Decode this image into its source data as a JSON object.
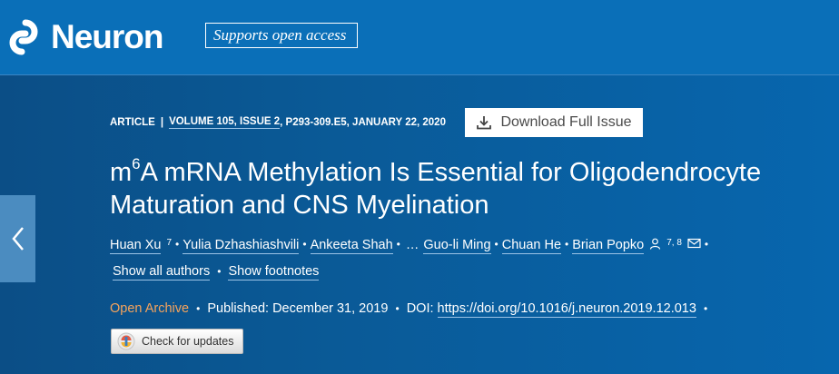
{
  "header": {
    "journal_name": "Neuron",
    "open_access_badge": "Supports open access"
  },
  "article": {
    "type": "ARTICLE",
    "separator": "|",
    "volume": "VOLUME 105, ISSUE 2",
    "pages_date": ", P293-309.E5, JANUARY 22, 2020",
    "download_label": "Download Full Issue",
    "title_prefix": "m",
    "title_sup": "6",
    "title_rest": "A mRNA Methylation Is Essential for Oligodendrocyte Maturation and CNS Myelination",
    "authors": [
      {
        "name": "Huan Xu",
        "sup": "7"
      },
      {
        "name": "Yulia Dzhashiashvili"
      },
      {
        "name": "Ankeeta Shah"
      },
      {
        "name": "Guo-li Ming"
      },
      {
        "name": "Chuan He"
      },
      {
        "name": "Brian Popko",
        "sup": "7, 8"
      }
    ],
    "ellipsis": "…",
    "show_all_authors": "Show all authors",
    "show_footnotes": "Show footnotes",
    "open_archive": "Open Archive",
    "published": "Published: December 31, 2019",
    "doi_label": "DOI:",
    "doi_link": "https://doi.org/10.1016/j.neuron.2019.12.013",
    "check_updates": "Check for updates"
  },
  "icons": {
    "logo": "neuron-logo-icon",
    "download": "download-icon",
    "prev": "chevron-left-icon",
    "person": "person-icon",
    "mail": "mail-icon",
    "check": "crossmark-icon"
  },
  "colors": {
    "header_bg": "#0a6fb8",
    "hero_bg": "#0a5a96",
    "open_archive": "#f5a35c"
  }
}
